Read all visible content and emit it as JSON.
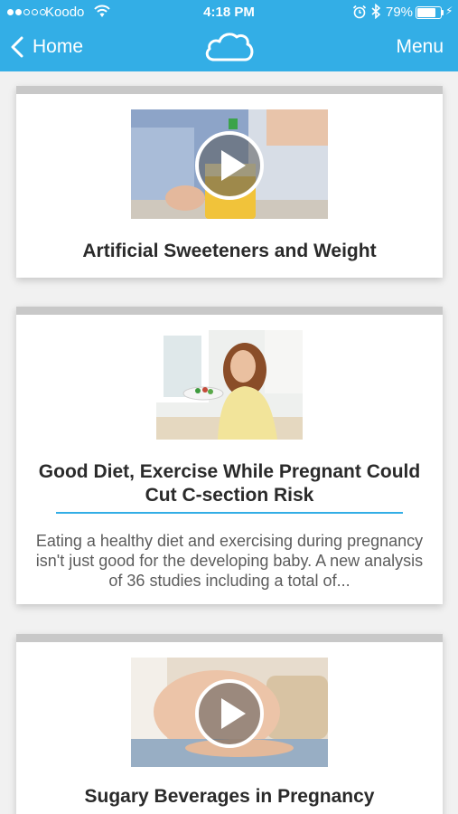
{
  "status_bar": {
    "carrier": "Koodo",
    "time": "4:18 PM",
    "battery": "79%",
    "battery_level": 0.79,
    "signal_bars": 2
  },
  "nav": {
    "back_label": "Home",
    "menu_label": "Menu",
    "logo_icon": "cloud-logo-icon"
  },
  "colors": {
    "nav_bar": "#33aee6",
    "accent": "#33aee6",
    "card_top_border": "#c8c8c8"
  },
  "feed": [
    {
      "title": "Artificial Sweeteners and Weight",
      "media": "video",
      "icon": "play-icon"
    },
    {
      "title": "Good Diet, Exercise While Pregnant Could Cut C-section Risk",
      "media": "image",
      "excerpt": "Eating a healthy diet and exercising during pregnancy isn't just good for the developing baby. A new analysis of 36 studies including a total of..."
    },
    {
      "title": "Sugary Beverages in Pregnancy",
      "media": "video",
      "icon": "play-icon"
    }
  ]
}
